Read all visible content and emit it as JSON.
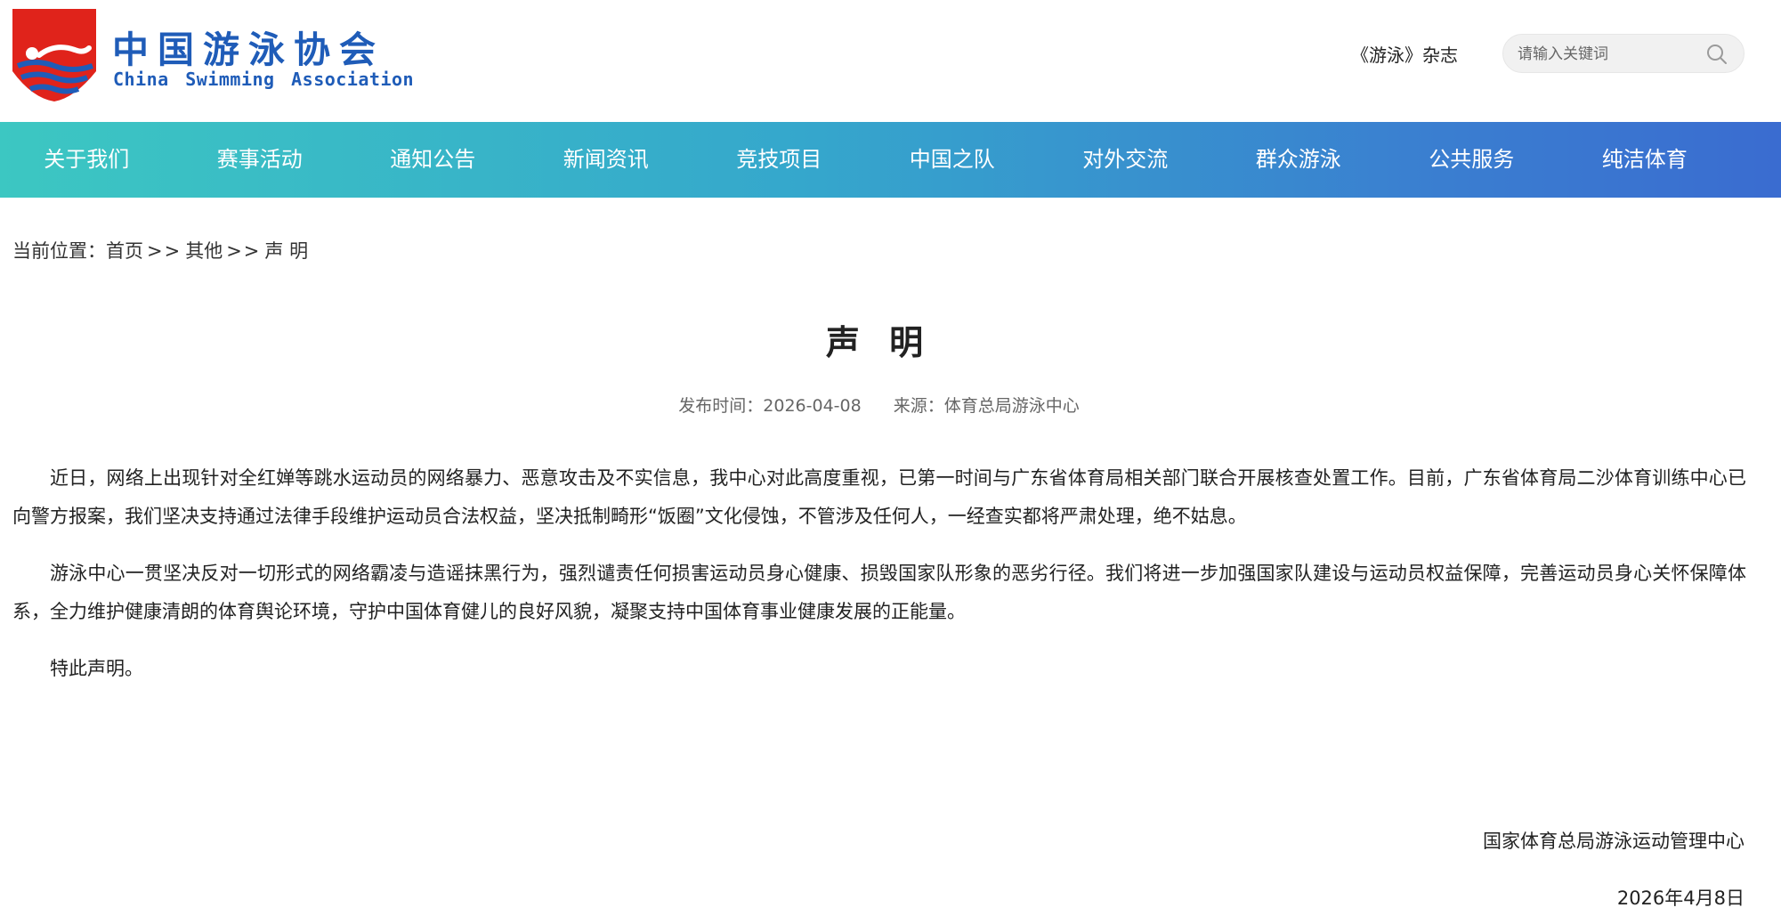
{
  "header": {
    "logo_cn": "中国游泳协会",
    "logo_en": "China Swimming Association",
    "magazine_link": "《游泳》杂志",
    "search_placeholder": "请输入关键词",
    "colors": {
      "brand_blue": "#1f5cb8",
      "brand_red": "#e0231b"
    }
  },
  "nav": {
    "items": [
      {
        "label": "关于我们"
      },
      {
        "label": "赛事活动"
      },
      {
        "label": "通知公告"
      },
      {
        "label": "新闻资讯"
      },
      {
        "label": "竞技项目"
      },
      {
        "label": "中国之队"
      },
      {
        "label": "对外交流"
      },
      {
        "label": "群众游泳"
      },
      {
        "label": "公共服务"
      },
      {
        "label": "纯洁体育"
      }
    ]
  },
  "breadcrumb": {
    "prefix": "当前位置：",
    "home": "首页",
    "separator": ">>",
    "category": "其他",
    "current": "声 明"
  },
  "article": {
    "title": "声 明",
    "publish_label": "发布时间：",
    "publish_date": "2026-04-08",
    "source_label": "来源：",
    "source": "体育总局游泳中心",
    "paragraphs": [
      "近日，网络上出现针对全红婵等跳水运动员的网络暴力、恶意攻击及不实信息，我中心对此高度重视，已第一时间与广东省体育局相关部门联合开展核查处置工作。目前，广东省体育局二沙体育训练中心已向警方报案，我们坚决支持通过法律手段维护运动员合法权益，坚决抵制畸形“饭圈”文化侵蚀，不管涉及任何人，一经查实都将严肃处理，绝不姑息。",
      "游泳中心一贯坚决反对一切形式的网络霸凌与造谣抹黑行为，强烈谴责任何损害运动员身心健康、损毁国家队形象的恶劣行径。我们将进一步加强国家队建设与运动员权益保障，完善运动员身心关怀保障体系，全力维护健康清朗的体育舆论环境，守护中国体育健儿的良好风貌，凝聚支持中国体育事业健康发展的正能量。",
      "特此声明。"
    ],
    "signature_org": "国家体育总局游泳运动管理中心",
    "signature_date": "2026年4月8日"
  }
}
